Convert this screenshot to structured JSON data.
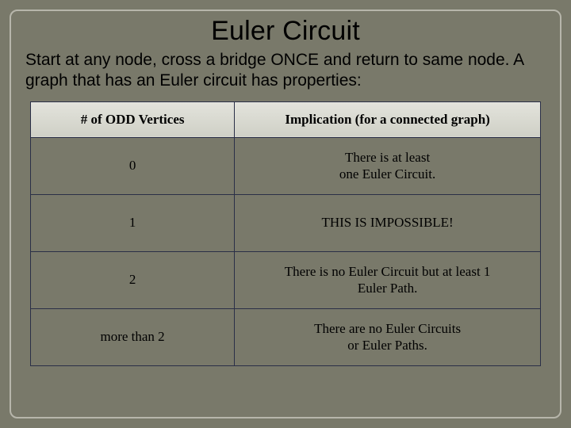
{
  "title": "Euler Circuit",
  "subtitle": "Start at any node, cross a bridge ONCE and return to same node.  A graph that has an Euler circuit has properties:",
  "headers": {
    "left": "# of ODD Vertices",
    "right": "Implication (for a connected graph)"
  },
  "rows": [
    {
      "left": "0",
      "right": "There is at least\none Euler Circuit."
    },
    {
      "left": "1",
      "right": "THIS IS IMPOSSIBLE!"
    },
    {
      "left": "2",
      "right": "There is no Euler Circuit but at least 1\nEuler Path."
    },
    {
      "left": "more than 2",
      "right": "There are no Euler Circuits\nor Euler Paths."
    }
  ],
  "chart_data": {
    "type": "table",
    "columns": [
      "# of ODD Vertices",
      "Implication (for a connected graph)"
    ],
    "data": [
      [
        "0",
        "There is at least one Euler Circuit."
      ],
      [
        "1",
        "THIS IS IMPOSSIBLE!"
      ],
      [
        "2",
        "There is no Euler Circuit but at least 1 Euler Path."
      ],
      [
        "more than 2",
        "There are no Euler Circuits or Euler Paths."
      ]
    ]
  }
}
